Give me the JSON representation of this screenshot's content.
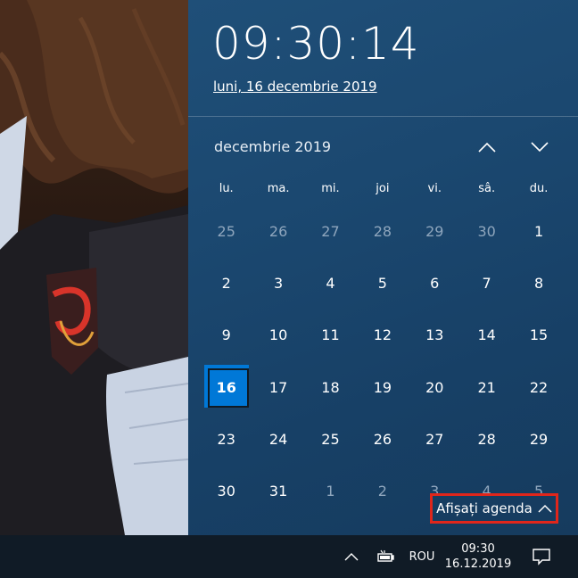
{
  "clock": {
    "time": "09:30:14",
    "date_link": "luni, 16 decembrie 2019"
  },
  "calendar": {
    "month_label": "decembrie 2019",
    "weekdays": [
      "lu.",
      "ma.",
      "mi.",
      "joi",
      "vi.",
      "sâ.",
      "du."
    ],
    "days": [
      {
        "label": "25",
        "current_month": false
      },
      {
        "label": "26",
        "current_month": false
      },
      {
        "label": "27",
        "current_month": false
      },
      {
        "label": "28",
        "current_month": false
      },
      {
        "label": "29",
        "current_month": false
      },
      {
        "label": "30",
        "current_month": false
      },
      {
        "label": "1",
        "current_month": true
      },
      {
        "label": "2",
        "current_month": true
      },
      {
        "label": "3",
        "current_month": true
      },
      {
        "label": "4",
        "current_month": true
      },
      {
        "label": "5",
        "current_month": true
      },
      {
        "label": "6",
        "current_month": true
      },
      {
        "label": "7",
        "current_month": true
      },
      {
        "label": "8",
        "current_month": true
      },
      {
        "label": "9",
        "current_month": true
      },
      {
        "label": "10",
        "current_month": true
      },
      {
        "label": "11",
        "current_month": true
      },
      {
        "label": "12",
        "current_month": true
      },
      {
        "label": "13",
        "current_month": true
      },
      {
        "label": "14",
        "current_month": true
      },
      {
        "label": "15",
        "current_month": true
      },
      {
        "label": "16",
        "current_month": true,
        "today": true
      },
      {
        "label": "17",
        "current_month": true
      },
      {
        "label": "18",
        "current_month": true
      },
      {
        "label": "19",
        "current_month": true
      },
      {
        "label": "20",
        "current_month": true
      },
      {
        "label": "21",
        "current_month": true
      },
      {
        "label": "22",
        "current_month": true
      },
      {
        "label": "23",
        "current_month": true
      },
      {
        "label": "24",
        "current_month": true
      },
      {
        "label": "25",
        "current_month": true
      },
      {
        "label": "26",
        "current_month": true
      },
      {
        "label": "27",
        "current_month": true
      },
      {
        "label": "28",
        "current_month": true
      },
      {
        "label": "29",
        "current_month": true
      },
      {
        "label": "30",
        "current_month": true
      },
      {
        "label": "31",
        "current_month": true
      },
      {
        "label": "1",
        "current_month": false
      },
      {
        "label": "2",
        "current_month": false
      },
      {
        "label": "3",
        "current_month": false
      },
      {
        "label": "4",
        "current_month": false
      },
      {
        "label": "5",
        "current_month": false
      }
    ],
    "agenda_button": "Afișați agenda",
    "icons": {
      "prev": "chevron-up-icon",
      "next": "chevron-down-icon",
      "agenda": "chevron-up-icon"
    }
  },
  "taskbar": {
    "language": "ROU",
    "time": "09:30",
    "date": "16.12.2019",
    "icons": [
      "chevron-up-icon",
      "battery-icon",
      "notification-icon"
    ]
  },
  "colors": {
    "flyout_bg": "#1b4870",
    "today_accent": "#0078d7",
    "highlight_border": "#e0261b",
    "taskbar_bg": "#101b26"
  }
}
